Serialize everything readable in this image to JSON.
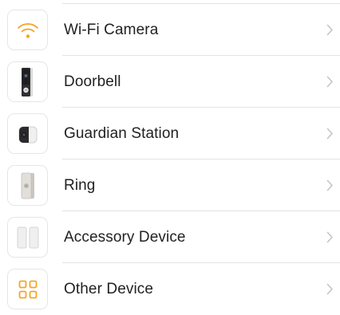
{
  "colors": {
    "accent": "#f5a52a",
    "separator": "#e3e3e6",
    "text": "#222222",
    "chevron": "#c4c4c7"
  },
  "devices": [
    {
      "label": "Wi-Fi Camera",
      "icon": "wifi-icon"
    },
    {
      "label": "Doorbell",
      "icon": "doorbell-icon"
    },
    {
      "label": "Guardian Station",
      "icon": "guardian-station-icon"
    },
    {
      "label": "Ring",
      "icon": "ring-chime-icon"
    },
    {
      "label": "Accessory Device",
      "icon": "accessory-sensor-icon"
    },
    {
      "label": "Other Device",
      "icon": "grid-icon"
    }
  ]
}
